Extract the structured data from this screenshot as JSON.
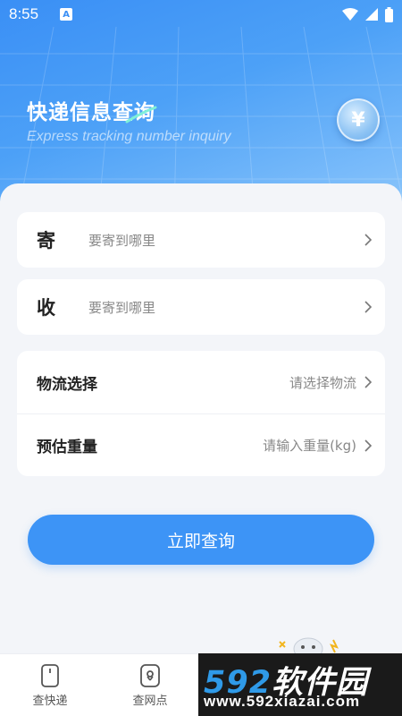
{
  "status_bar": {
    "time": "8:55",
    "notification_letter": "A"
  },
  "hero": {
    "title": "快递信息查询",
    "subtitle": "Express tracking number inquiry",
    "coin_symbol": "¥"
  },
  "address": {
    "sender": {
      "tag": "寄",
      "placeholder": "要寄到哪里"
    },
    "receiver": {
      "tag": "收",
      "placeholder": "要寄到哪里"
    }
  },
  "options": {
    "logistics": {
      "label": "物流选择",
      "value": "请选择物流"
    },
    "weight": {
      "label": "预估重量",
      "value": "请输入重量(kg)"
    }
  },
  "query_button": {
    "label": "立即查询"
  },
  "tabbar": {
    "tabs": [
      {
        "label": "查快递",
        "icon": "phone-icon"
      },
      {
        "label": "查网点",
        "icon": "location-pin-icon"
      }
    ]
  },
  "watermark": {
    "number": "592",
    "name": "软件园",
    "url": "www.592xiazai.com"
  },
  "colors": {
    "accent": "#3d94f6",
    "hero_start": "#3a8ff5",
    "hero_end": "#8cc6fb"
  }
}
